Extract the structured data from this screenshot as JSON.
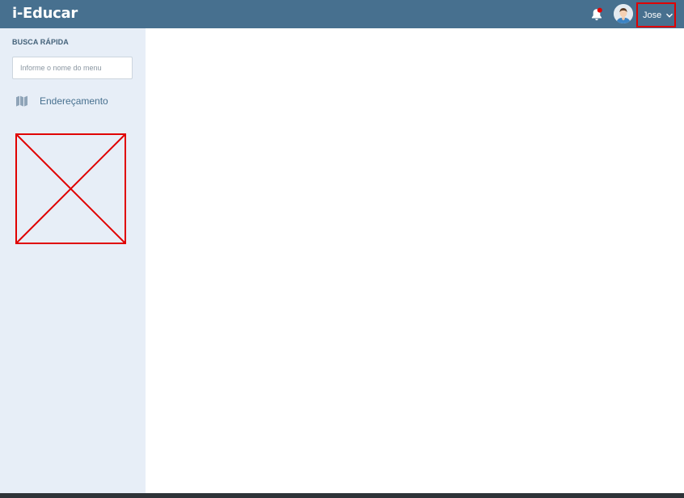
{
  "app": {
    "title": "i-Educar"
  },
  "header": {
    "notification_icon": "bell-icon",
    "notification_badge_color": "#e00000",
    "avatar_icon": "user-avatar",
    "user_name": "Jose",
    "user_menu_icon": "chevron-down-icon",
    "bar_color": "#47708f"
  },
  "sidebar": {
    "quick_search_title": "BUSCA RÁPIDA",
    "search_placeholder": "Informe o nome do menu",
    "items": [
      {
        "label": "Endereçamento",
        "icon": "map-icon"
      }
    ],
    "broken_image_icon": "broken-image-placeholder"
  },
  "colors": {
    "sidebar_bg": "#e7eef7",
    "highlight": "#e00000"
  }
}
